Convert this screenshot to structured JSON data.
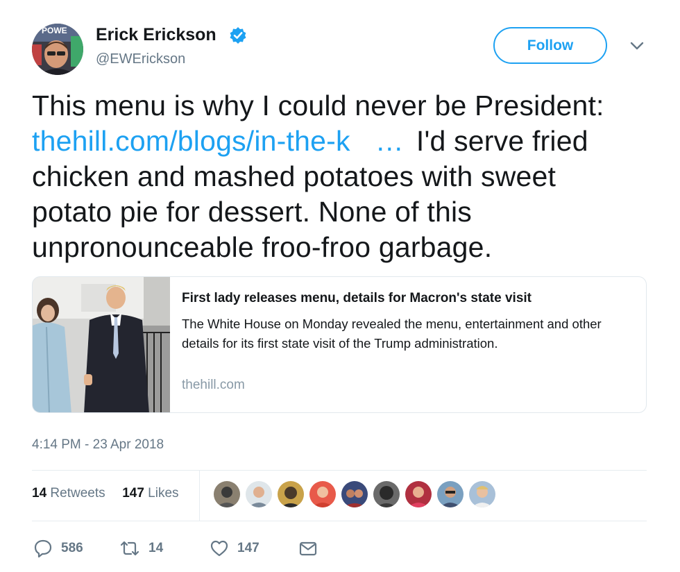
{
  "header": {
    "name": "Erick Erickson",
    "handle": "@EWErickson",
    "follow_label": "Follow",
    "verified_icon": "verified-badge-icon",
    "avatar_text": "POWE"
  },
  "tweet": {
    "line1": "This menu is why I could never be President:",
    "link_text": "thehill.com/blogs/in-the-k",
    "link_ellipsis": "…",
    "line2_rest": "I'd serve fried",
    "line3": "chicken and mashed potatoes with sweet",
    "line4": "potato pie for dessert.  None of this",
    "line5": "unpronounceable froo-froo garbage."
  },
  "card": {
    "title": "First lady releases menu, details for Macron's state visit",
    "description": "The White House on Monday revealed the menu, entertainment and other details for its first state visit of the Trump administration.",
    "domain": "thehill.com"
  },
  "timestamp": "4:14 PM - 23 Apr 2018",
  "stats": {
    "retweets_count": "14",
    "retweets_label": "Retweets",
    "likes_count": "147",
    "likes_label": "Likes"
  },
  "actions": {
    "reply_count": "586",
    "retweet_count": "14",
    "like_count": "147"
  },
  "colors": {
    "accent": "#1da1f2",
    "text": "#14171a",
    "muted": "#657786",
    "border": "#e1e8ed"
  }
}
